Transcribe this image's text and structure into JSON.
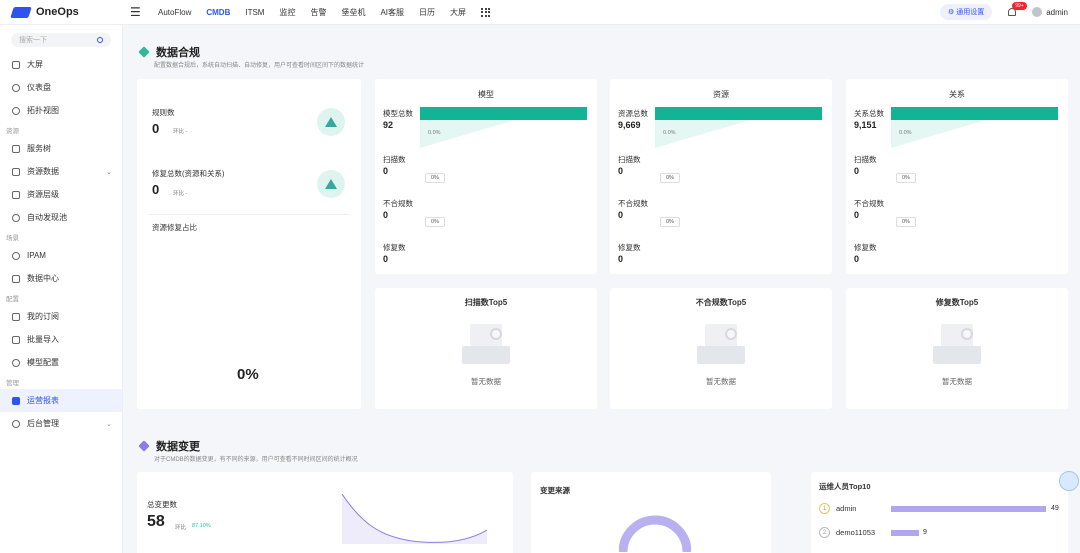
{
  "header": {
    "app_name": "OneOps",
    "nav": [
      "AutoFlow",
      "CMDB",
      "ITSM",
      "监控",
      "告警",
      "堡垒机",
      "AI客服",
      "日历",
      "大屏"
    ],
    "active_nav": "CMDB",
    "settings_label": "通用设置",
    "notification_badge": "99+",
    "user": "admin"
  },
  "sidebar": {
    "search_placeholder": "搜索一下",
    "items": [
      {
        "label": "大屏",
        "icon": "screen-icon"
      },
      {
        "label": "仪表盘",
        "icon": "dashboard-icon"
      },
      {
        "label": "拓扑视图",
        "icon": "topology-icon"
      },
      {
        "group": "资源"
      },
      {
        "label": "服务树",
        "icon": "tree-icon"
      },
      {
        "label": "资源数据",
        "icon": "data-icon",
        "expand": true
      },
      {
        "label": "资源层级",
        "icon": "hierarchy-icon"
      },
      {
        "label": "自动发现池",
        "icon": "discover-icon"
      },
      {
        "group": "场景"
      },
      {
        "label": "IPAM",
        "icon": "ipam-icon"
      },
      {
        "label": "数据中心",
        "icon": "datacenter-icon"
      },
      {
        "group": "配置"
      },
      {
        "label": "我的订阅",
        "icon": "subscribe-icon"
      },
      {
        "label": "批量导入",
        "icon": "import-icon"
      },
      {
        "label": "模型配置",
        "icon": "model-icon"
      },
      {
        "group": "管理"
      },
      {
        "label": "运营报表",
        "icon": "report-icon",
        "active": true
      },
      {
        "label": "后台管理",
        "icon": "admin-icon",
        "expand": true
      }
    ]
  },
  "compliance": {
    "title": "数据合规",
    "desc": "配置数据合规后，系统自动扫描、自动修复，用户可查看时间区间下的数据统计",
    "rules_label": "规则数",
    "rules_value": "0",
    "rules_ring": "环比 -",
    "repair_label": "修复总数(资源和关系)",
    "repair_value": "0",
    "repair_ring": "环比 -",
    "ratio_label": "资源修复占比",
    "ratio_value": "0%",
    "columns": [
      {
        "title": "模型",
        "total_label": "模型总数",
        "total_value": "92",
        "total_pct": "0.0%",
        "scan_label": "扫描数",
        "scan_value": "0",
        "scan_pct": "0%",
        "noncomp_label": "不合规数",
        "noncomp_value": "0",
        "noncomp_pct": "0%",
        "repair_label": "修复数",
        "repair_value": "0"
      },
      {
        "title": "资源",
        "total_label": "资源总数",
        "total_value": "9,669",
        "total_pct": "0.0%",
        "scan_label": "扫描数",
        "scan_value": "0",
        "scan_pct": "0%",
        "noncomp_label": "不合规数",
        "noncomp_value": "0",
        "noncomp_pct": "0%",
        "repair_label": "修复数",
        "repair_value": "0"
      },
      {
        "title": "关系",
        "total_label": "关系总数",
        "total_value": "9,151",
        "total_pct": "0.0%",
        "scan_label": "扫描数",
        "scan_value": "0",
        "scan_pct": "0%",
        "noncomp_label": "不合规数",
        "noncomp_value": "0",
        "noncomp_pct": "0%",
        "repair_label": "修复数",
        "repair_value": "0"
      }
    ],
    "top5": [
      {
        "title": "扫描数Top5",
        "empty": "暂无数据"
      },
      {
        "title": "不合规数Top5",
        "empty": "暂无数据"
      },
      {
        "title": "修复数Top5",
        "empty": "暂无数据"
      }
    ]
  },
  "changes": {
    "title": "数据变更",
    "desc": "对于CMDB的数据变更，有不同的来源，用户可查看不同时间区间的统计概况",
    "total_label": "总变更数",
    "total_value": "58",
    "ring_label": "环比",
    "ring_value": "87.10%",
    "source_title": "变更来源",
    "top10_title": "运维人员Top10",
    "top10": [
      {
        "rank": "1",
        "name": "admin",
        "value": "49",
        "fraction": 1.0
      },
      {
        "rank": "2",
        "name": "demo11053",
        "value": "9",
        "fraction": 0.18
      }
    ]
  },
  "colors": {
    "accent": "#2f54eb",
    "teal": "#12b494",
    "purple": "#b1a7ec"
  }
}
